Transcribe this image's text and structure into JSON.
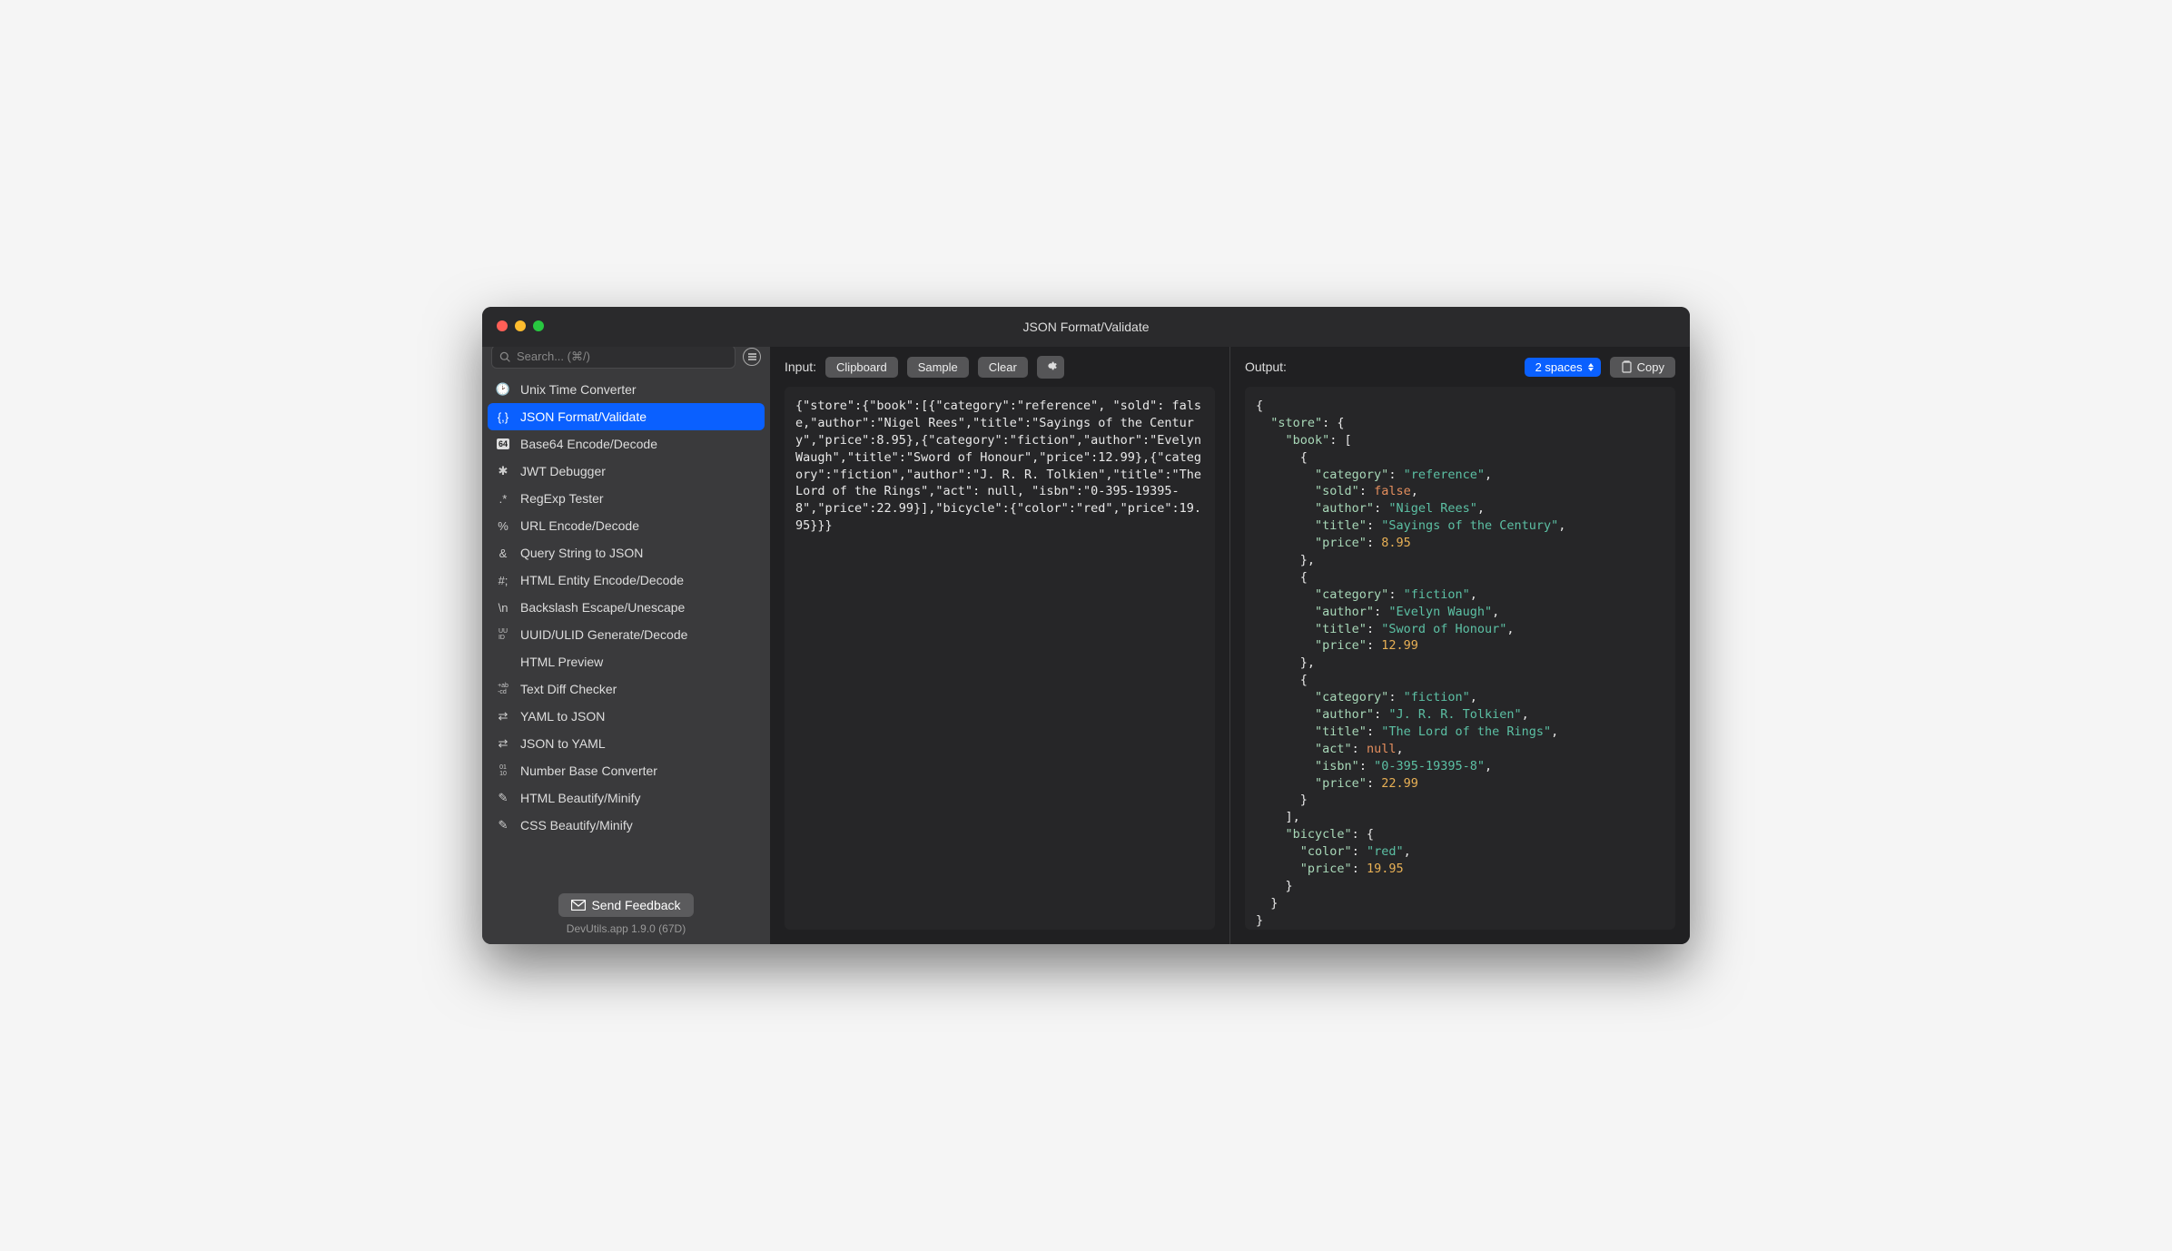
{
  "window": {
    "title": "JSON Format/Validate"
  },
  "search": {
    "placeholder": "Search... (⌘/)"
  },
  "sidebar": {
    "items": [
      {
        "label": "Unix Time Converter",
        "icon": "clock"
      },
      {
        "label": "JSON Format/Validate",
        "icon": "braces",
        "selected": true
      },
      {
        "label": "Base64 Encode/Decode",
        "icon": "b64"
      },
      {
        "label": "JWT Debugger",
        "icon": "jwt"
      },
      {
        "label": "RegExp Tester",
        "icon": "regex"
      },
      {
        "label": "URL Encode/Decode",
        "icon": "pct"
      },
      {
        "label": "Query String to JSON",
        "icon": "amp"
      },
      {
        "label": "HTML Entity Encode/Decode",
        "icon": "hash"
      },
      {
        "label": "Backslash Escape/Unescape",
        "icon": "bslash"
      },
      {
        "label": "UUID/ULID Generate/Decode",
        "icon": "uuid"
      },
      {
        "label": "HTML Preview",
        "icon": "html"
      },
      {
        "label": "Text Diff Checker",
        "icon": "diff"
      },
      {
        "label": "YAML to JSON",
        "icon": "swap"
      },
      {
        "label": "JSON to YAML",
        "icon": "swap"
      },
      {
        "label": "Number Base Converter",
        "icon": "bits"
      },
      {
        "label": "HTML Beautify/Minify",
        "icon": "wand"
      },
      {
        "label": "CSS Beautify/Minify",
        "icon": "wand"
      }
    ]
  },
  "footer": {
    "feedback": "Send Feedback",
    "version": "DevUtils.app 1.9.0 (67D)"
  },
  "input": {
    "label": "Input:",
    "buttons": {
      "clipboard": "Clipboard",
      "sample": "Sample",
      "clear": "Clear"
    },
    "text": "{\"store\":{\"book\":[{\"category\":\"reference\", \"sold\": false,\"author\":\"Nigel Rees\",\"title\":\"Sayings of the Century\",\"price\":8.95},{\"category\":\"fiction\",\"author\":\"Evelyn Waugh\",\"title\":\"Sword of Honour\",\"price\":12.99},{\"category\":\"fiction\",\"author\":\"J. R. R. Tolkien\",\"title\":\"The Lord of the Rings\",\"act\": null, \"isbn\":\"0-395-19395-8\",\"price\":22.99}],\"bicycle\":{\"color\":\"red\",\"price\":19.95}}}"
  },
  "output": {
    "label": "Output:",
    "indent": "2 spaces",
    "copy": "Copy",
    "json": {
      "store": {
        "book": [
          {
            "category": "reference",
            "sold": false,
            "author": "Nigel Rees",
            "title": "Sayings of the Century",
            "price": 8.95
          },
          {
            "category": "fiction",
            "author": "Evelyn Waugh",
            "title": "Sword of Honour",
            "price": 12.99
          },
          {
            "category": "fiction",
            "author": "J. R. R. Tolkien",
            "title": "The Lord of the Rings",
            "act": null,
            "isbn": "0-395-19395-8",
            "price": 22.99
          }
        ],
        "bicycle": {
          "color": "red",
          "price": 19.95
        }
      }
    }
  },
  "icons": {
    "clock": "🕑",
    "braces": "{,}",
    "b64": "64",
    "jwt": "✱",
    "regex": ".*",
    "pct": "%",
    "amp": "&",
    "hash": "#;",
    "bslash": "\\n",
    "uuid": "UU\nID",
    "html": "</>",
    "diff": "+ab\n-cd",
    "swap": "⇄",
    "bits": "01\n10",
    "wand": "✎"
  }
}
